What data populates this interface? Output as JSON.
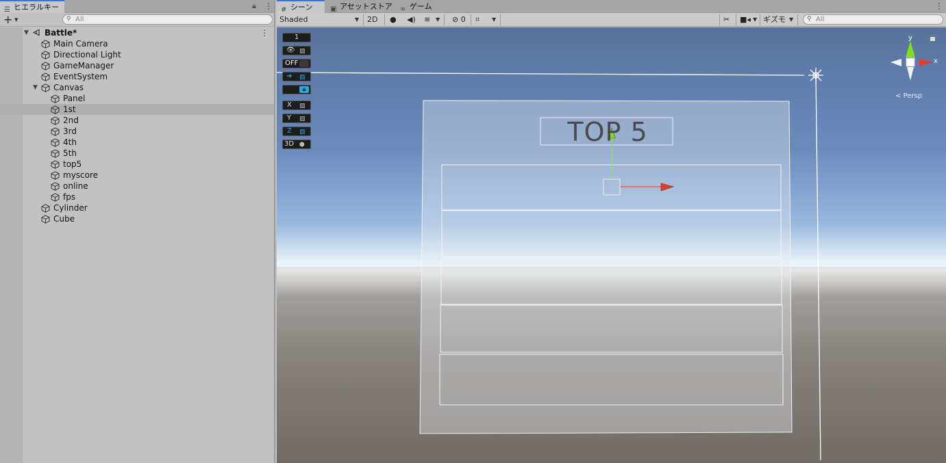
{
  "hierarchy": {
    "tab_label": "ヒエラルキー",
    "search_placeholder": "All",
    "scene_name": "Battle*",
    "items": [
      {
        "label": "Main Camera",
        "depth": 1
      },
      {
        "label": "Directional Light",
        "depth": 1
      },
      {
        "label": "GameManager",
        "depth": 1
      },
      {
        "label": "EventSystem",
        "depth": 1
      },
      {
        "label": "Canvas",
        "depth": 1,
        "expanded": true
      },
      {
        "label": "Panel",
        "depth": 2
      },
      {
        "label": "1st",
        "depth": 2,
        "selected": true
      },
      {
        "label": "2nd",
        "depth": 2
      },
      {
        "label": "3rd",
        "depth": 2
      },
      {
        "label": "4th",
        "depth": 2
      },
      {
        "label": "5th",
        "depth": 2
      },
      {
        "label": "top5",
        "depth": 2
      },
      {
        "label": "myscore",
        "depth": 2
      },
      {
        "label": "online",
        "depth": 2
      },
      {
        "label": "fps",
        "depth": 2
      },
      {
        "label": "Cylinder",
        "depth": 1
      },
      {
        "label": "Cube",
        "depth": 1
      }
    ]
  },
  "scene": {
    "tabs": [
      {
        "label": "シーン",
        "icon": "grid-icon",
        "active": true
      },
      {
        "label": "アセットストア",
        "icon": "store-bag-icon",
        "active": false
      },
      {
        "label": "ゲーム",
        "icon": "gamepad-icon",
        "active": false
      }
    ],
    "toolbar": {
      "shading_mode": "Shaded",
      "mode_2d": "2D",
      "hidden_count": "0",
      "gizmos_label": "ギズモ",
      "search_placeholder": "All"
    },
    "overlay": {
      "layer_number": "1",
      "off_label": "OFF",
      "axis_x": "X",
      "axis_y": "Y",
      "axis_z": "Z",
      "mode_3d": "3D"
    },
    "ui_text": "TOP 5",
    "orientation_gizmo": {
      "projection_label": "Persp",
      "axis_y": "y",
      "axis_x": "x"
    }
  },
  "colors": {
    "selection_blue": "#3a72d8",
    "overlay_active_blue": "#2aa8e0",
    "move_x_red": "#e04030",
    "move_y_green": "#80dd20"
  }
}
